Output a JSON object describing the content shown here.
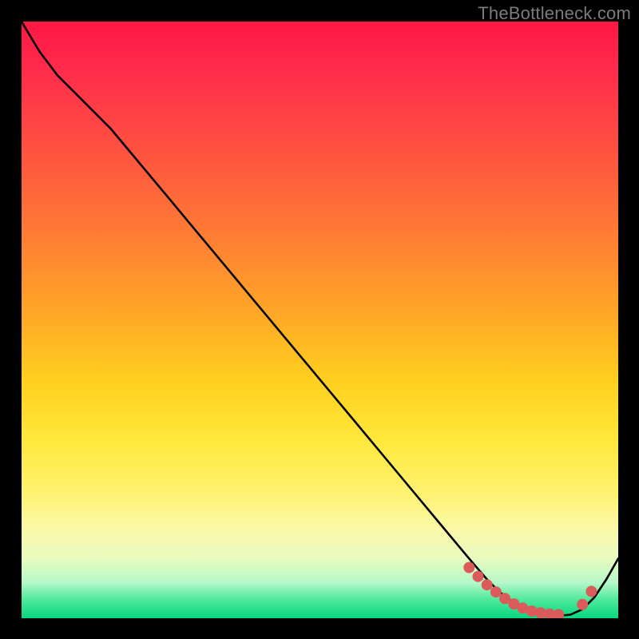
{
  "watermark": {
    "text": "TheBottleneck.com"
  },
  "chart_data": {
    "type": "line",
    "title": "",
    "xlabel": "",
    "ylabel": "",
    "xlim": [
      0,
      100
    ],
    "ylim": [
      0,
      100
    ],
    "series": [
      {
        "name": "bottleneck-curve",
        "x": [
          0,
          3,
          6,
          10,
          15,
          20,
          25,
          30,
          35,
          40,
          45,
          50,
          55,
          60,
          65,
          70,
          75,
          78,
          80,
          82,
          84,
          86,
          88,
          90,
          92,
          94,
          96,
          98,
          100
        ],
        "y": [
          100,
          95,
          91,
          87,
          82,
          76,
          70,
          64,
          58,
          52,
          46,
          40,
          34,
          28,
          22,
          16,
          10,
          6.5,
          4.5,
          3,
          1.8,
          1,
          0.5,
          0.4,
          0.6,
          1.5,
          3.5,
          6.5,
          10
        ]
      }
    ],
    "markers": {
      "name": "highlight-dots",
      "x": [
        75,
        76.5,
        78,
        79.5,
        81,
        82.5,
        84,
        85.5,
        87,
        88.5,
        90,
        94,
        95.5
      ],
      "y": [
        8.5,
        7,
        5.6,
        4.4,
        3.3,
        2.4,
        1.7,
        1.2,
        0.9,
        0.7,
        0.6,
        2.3,
        4.5
      ]
    },
    "colors": {
      "line": "#000000",
      "markers": "#db5a5a",
      "gradient_top": "#ff1744",
      "gradient_mid": "#ffe83a",
      "gradient_bottom": "#08d77e"
    }
  }
}
